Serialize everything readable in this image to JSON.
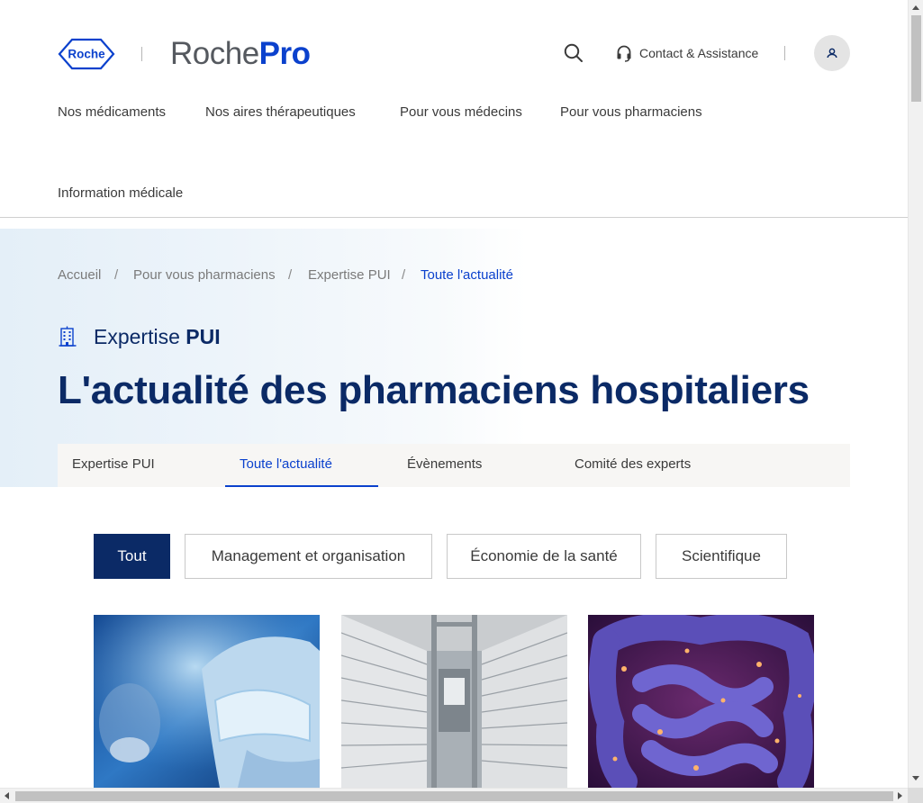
{
  "header": {
    "logo_text": "Roche",
    "brand_light": "Roche",
    "brand_bold": "Pro",
    "search_icon": "search-icon",
    "contact_icon": "headset-icon",
    "contact_label": "Contact & Assistance",
    "user_icon": "user-icon"
  },
  "nav": {
    "items": [
      {
        "label": "Nos médicaments"
      },
      {
        "label": "Nos aires thérapeutiques"
      },
      {
        "label": "Pour vous médecins"
      },
      {
        "label": "Pour vous pharmaciens"
      },
      {
        "label": "Information médicale"
      }
    ]
  },
  "breadcrumb": {
    "separator": "/",
    "items": [
      {
        "label": "Accueil"
      },
      {
        "label": "Pour vous pharmaciens"
      },
      {
        "label": "Expertise PUI"
      },
      {
        "label": "Toute l'actualité"
      }
    ]
  },
  "section": {
    "icon": "hospital-building-icon",
    "title_light": "Expertise",
    "title_bold": "PUI"
  },
  "page_title": "L'actualité des pharmaciens hospitaliers",
  "tabs": [
    {
      "label": "Expertise PUI",
      "active": false
    },
    {
      "label": "Toute l'actualité",
      "active": true
    },
    {
      "label": "Évènements",
      "active": false
    },
    {
      "label": "Comité des experts",
      "active": false
    }
  ],
  "filters": [
    {
      "label": "Tout",
      "active": true
    },
    {
      "label": "Management et organisation",
      "active": false
    },
    {
      "label": "Économie de la santé",
      "active": false
    },
    {
      "label": "Scientifique",
      "active": false
    }
  ],
  "cards": [
    {
      "image": "scientist-lab-photo"
    },
    {
      "image": "automated-pharmacy-storage-photo"
    },
    {
      "image": "intestine-illustration"
    }
  ],
  "colors": {
    "brand_blue": "#0b41cd",
    "navy": "#0b2a66",
    "text": "#3a3a3a"
  }
}
